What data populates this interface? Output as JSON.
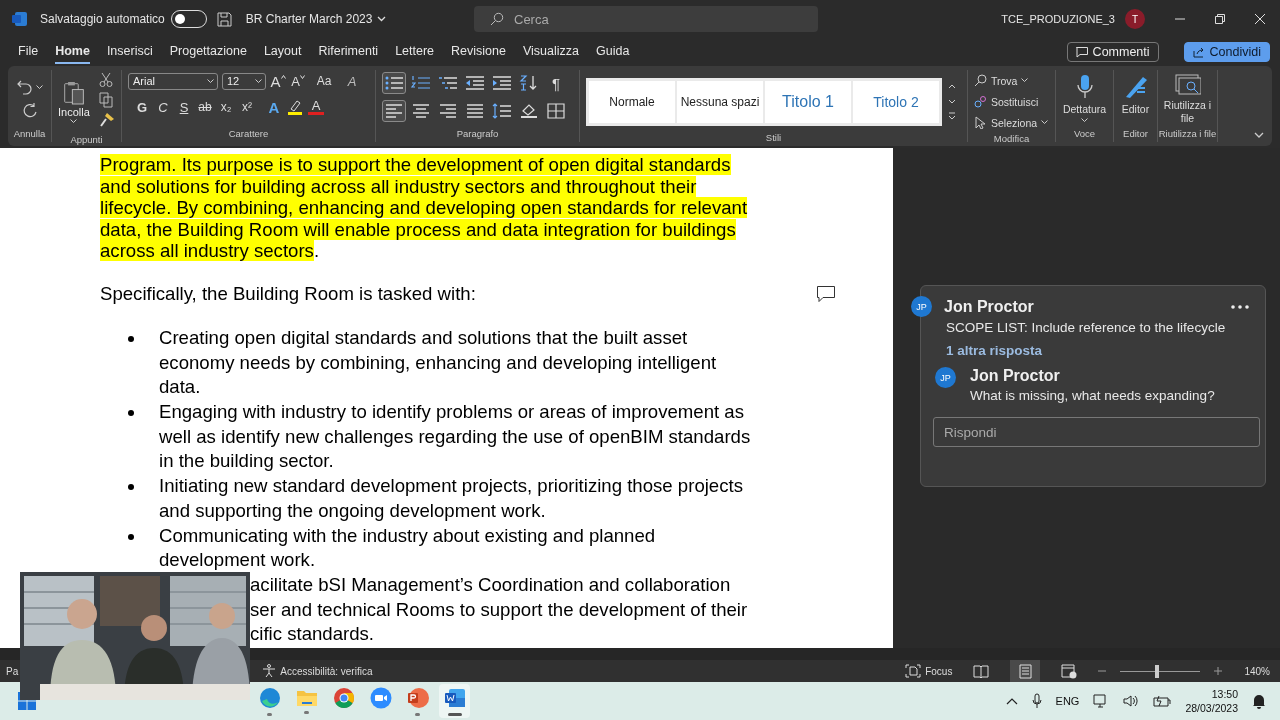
{
  "title_bar": {
    "autosave_label": "Salvataggio automatico",
    "autosave_on": false,
    "document_title": "BR Charter March 2023",
    "search_placeholder": "Cerca",
    "account": "TCE_PRODUZIONE_3",
    "avatar_initial": "T"
  },
  "tabs": [
    {
      "label": "File",
      "selected": false
    },
    {
      "label": "Home",
      "selected": true
    },
    {
      "label": "Inserisci",
      "selected": false
    },
    {
      "label": "Progettazione",
      "selected": false
    },
    {
      "label": "Layout",
      "selected": false
    },
    {
      "label": "Riferimenti",
      "selected": false
    },
    {
      "label": "Lettere",
      "selected": false
    },
    {
      "label": "Revisione",
      "selected": false
    },
    {
      "label": "Visualizza",
      "selected": false
    },
    {
      "label": "Guida",
      "selected": false
    }
  ],
  "header_buttons": {
    "comments": "Commenti",
    "share": "Condividi"
  },
  "ribbon": {
    "undo": {
      "label": "Annulla"
    },
    "clipboard": {
      "label": "Appunti",
      "paste": "Incolla"
    },
    "font": {
      "label": "Carattere",
      "font_name": "Arial",
      "font_size": "12",
      "size_buttons": [
        {
          "label": "A",
          "kind": "grow"
        },
        {
          "label": "A",
          "kind": "shrink"
        },
        {
          "label": "Aa",
          "kind": "case"
        },
        {
          "label": "A",
          "kind": "clear"
        }
      ],
      "format_buttons": [
        {
          "label": "G",
          "kind": "bold"
        },
        {
          "label": "C",
          "kind": "italic"
        },
        {
          "label": "S",
          "kind": "underline"
        },
        {
          "label": "ab",
          "kind": "strike"
        },
        {
          "label": "x₂",
          "kind": "sub"
        },
        {
          "label": "x²",
          "kind": "sup"
        },
        {
          "label": "A",
          "kind": "effects"
        },
        {
          "kind": "highlight"
        },
        {
          "label": "A",
          "kind": "color"
        }
      ]
    },
    "paragraph": {
      "label": "Paragrafo",
      "row_1": [
        {
          "kind": "bullets",
          "selected": true
        },
        {
          "kind": "numbering",
          "selected": false
        },
        {
          "kind": "multilevel",
          "selected": false
        },
        {
          "kind": "outdent",
          "selected": false
        },
        {
          "kind": "indent",
          "selected": false
        },
        {
          "kind": "sort",
          "selected": false
        },
        {
          "kind": "marks",
          "label": "¶",
          "selected": false
        }
      ],
      "row_2": [
        {
          "kind": "align-left",
          "selected": true
        },
        {
          "kind": "align-center",
          "selected": false
        },
        {
          "kind": "align-right",
          "selected": false
        },
        {
          "kind": "justify",
          "selected": false
        },
        {
          "kind": "spacing",
          "selected": false
        },
        {
          "kind": "shading",
          "selected": false
        },
        {
          "kind": "borders",
          "selected": false
        }
      ]
    },
    "styles": {
      "label": "Stili",
      "items": [
        {
          "label": "Normale",
          "kind": "normal"
        },
        {
          "label": "Nessuna spazi",
          "kind": "normal"
        },
        {
          "label": "Titolo 1",
          "kind": "heading1"
        },
        {
          "label": "Titolo 2",
          "kind": "heading2"
        }
      ]
    },
    "editing": {
      "label": "Modifica",
      "commands": [
        {
          "label": "Trova",
          "kind": "find"
        },
        {
          "label": "Sostituisci",
          "kind": "replace"
        },
        {
          "label": "Seleziona",
          "kind": "select"
        }
      ]
    },
    "voice": {
      "label": "Voce",
      "command": "Dettatura"
    },
    "editor": {
      "label": "Editor",
      "command": "Editor"
    },
    "reuse": {
      "label": "Riutilizza i file",
      "command": "Riutilizza i file"
    }
  },
  "document": {
    "paragraph": {
      "highlighted": "Program. Its purpose is to support the development of open digital standards and solutions for building across all industry sectors and throughout their lifecycle. By combining, enhancing and developing open standards for relevant data, the Building Room will enable process and data integration for buildings across all industry sectors",
      "after": "."
    },
    "intro": "Specifically, the Building Room is tasked with:",
    "bullets": [
      "Creating open digital standards and solutions that the built asset economy needs by combining, enhancing and developing intelligent data.",
      "Engaging with industry to identify problems or areas of improvement as well as identify new challenges regarding the use of openBIM standards in the building sector.",
      "Initiating new standard development projects, prioritizing those projects and supporting the ongoing development work.",
      "Communicating with the industry about existing and planned development work."
    ],
    "fragment_lines": [
      "acilitate bSI Management’s Coordination and collaboration",
      "ser and technical Rooms to support the development of their",
      "cific standards."
    ]
  },
  "comment_thread": {
    "initials": "JP",
    "author": "Jon Proctor",
    "text": "SCOPE LIST: Include reference to the lifecycle",
    "more_replies": "1 altra risposta",
    "replies": [
      {
        "initials": "JP",
        "author": "Jon Proctor",
        "text": "What is missing, what needs expanding?"
      }
    ],
    "reply_placeholder": "Rispondi"
  },
  "status_bar": {
    "page": "Pa",
    "accessibility": "Accessibilità: verifica",
    "focus": "Focus",
    "views": [
      {
        "kind": "read",
        "selected": false
      },
      {
        "kind": "print",
        "selected": true
      },
      {
        "kind": "web",
        "selected": false
      }
    ],
    "zoom": {
      "level": 0.46,
      "reading": "140%"
    }
  },
  "taskbar": {
    "apps": [
      {
        "kind": "edge",
        "running": true,
        "selected": false
      },
      {
        "kind": "folder",
        "running": true,
        "selected": false
      },
      {
        "kind": "chrome",
        "running": false,
        "selected": false
      },
      {
        "kind": "zoom",
        "running": false,
        "selected": false
      },
      {
        "kind": "powerpoint",
        "running": true,
        "selected": false
      },
      {
        "kind": "word",
        "running": true,
        "selected": true
      }
    ],
    "language": "ENG",
    "time": "13:50",
    "date": "28/03/2023"
  }
}
